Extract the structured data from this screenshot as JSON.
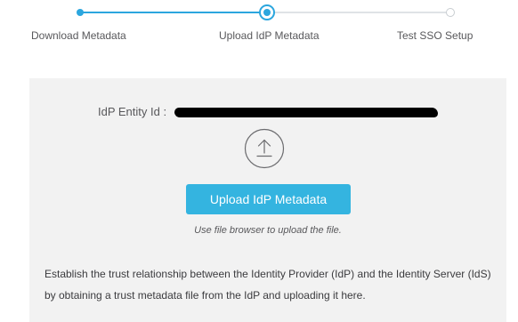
{
  "stepper": {
    "steps": [
      {
        "label": "Download Metadata",
        "state": "complete"
      },
      {
        "label": "Upload IdP Metadata",
        "state": "current"
      },
      {
        "label": "Test SSO Setup",
        "state": "pending"
      }
    ],
    "active_color": "#2ba6de",
    "inactive_color": "#dfe3e6"
  },
  "panel": {
    "entity_id_label": "IdP Entity Id :",
    "entity_id_value": "",
    "entity_id_redacted": true,
    "upload_icon": "upload-arrow-icon",
    "upload_button_label": "Upload IdP Metadata",
    "upload_hint": "Use file browser to upload the file.",
    "description": "Establish the trust relationship between the Identity Provider (IdP) and the Identity Server (IdS) by obtaining a trust metadata file from the IdP and uploading it here.",
    "button_color": "#34b4e0",
    "background_color": "#f2f2f2"
  }
}
